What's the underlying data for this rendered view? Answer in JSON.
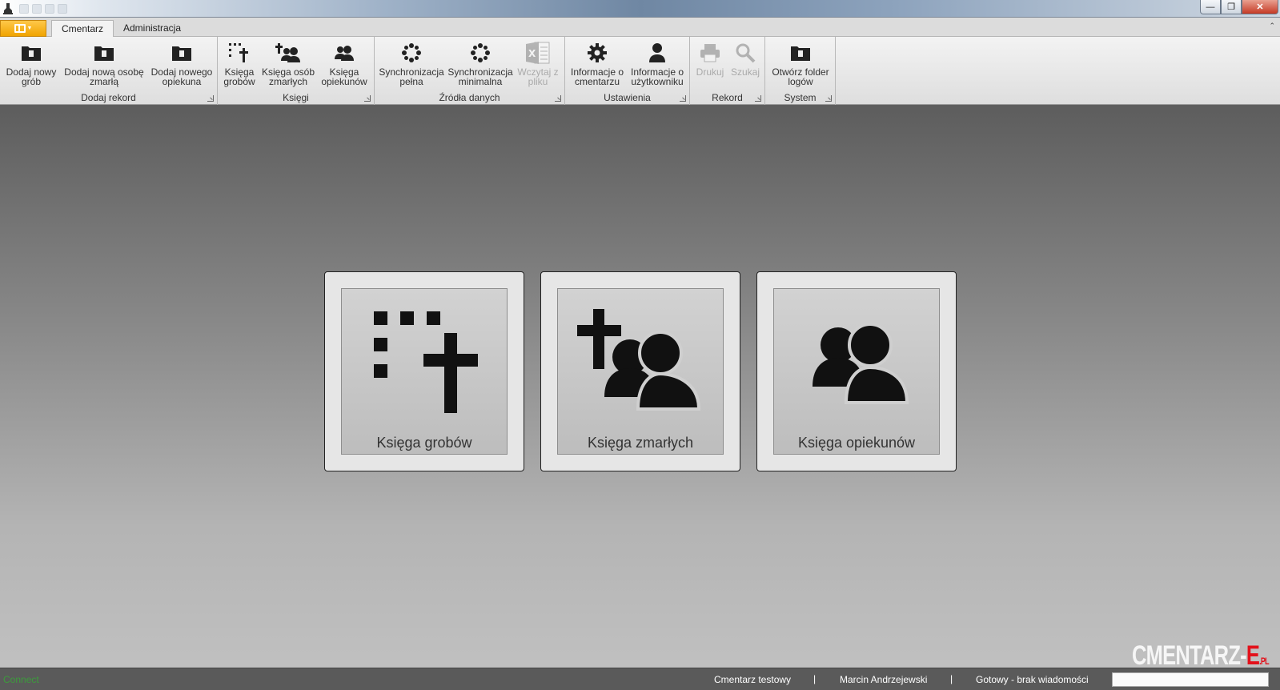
{
  "ribbon": {
    "tabs": [
      "Cmentarz",
      "Administracja"
    ],
    "groups": {
      "dodaj_rekord": {
        "label": "Dodaj rekord",
        "buttons": [
          "Dodaj nowy\ngrób",
          "Dodaj nową osobę\nzmarłą",
          "Dodaj nowego\nopiekuna"
        ]
      },
      "ksiegi": {
        "label": "Księgi",
        "buttons": [
          "Księga\ngrobów",
          "Księga osób\nzmarłych",
          "Księga\nopiekunów"
        ]
      },
      "zrodla": {
        "label": "Źródła danych",
        "buttons": [
          "Synchronizacja\npełna",
          "Synchronizacja\nminimalna",
          "Wczytaj z\npliku"
        ]
      },
      "ustawienia": {
        "label": "Ustawienia",
        "buttons": [
          "Informacje o\ncmentarzu",
          "Informacje o\nużytkowniku"
        ]
      },
      "rekord": {
        "label": "Rekord",
        "buttons": [
          "Drukuj",
          "Szukaj"
        ]
      },
      "system": {
        "label": "System",
        "buttons": [
          "Otwórz folder\nlogów"
        ]
      }
    }
  },
  "tiles": [
    "Księga grobów",
    "Księga zmarłych",
    "Księga opiekunów"
  ],
  "brand": {
    "main": "CMENTARZ-",
    "e": "E",
    "pl": ".PL"
  },
  "status": {
    "connection": "Connect",
    "cemetery": "Cmentarz testowy",
    "user": "Marcin Andrzejewski",
    "message": "Gotowy - brak wiadomości",
    "separator": "|"
  },
  "colors": {
    "accent": "#f0a400",
    "connect": "#3c9c3c",
    "brand_red": "#e3111b"
  }
}
